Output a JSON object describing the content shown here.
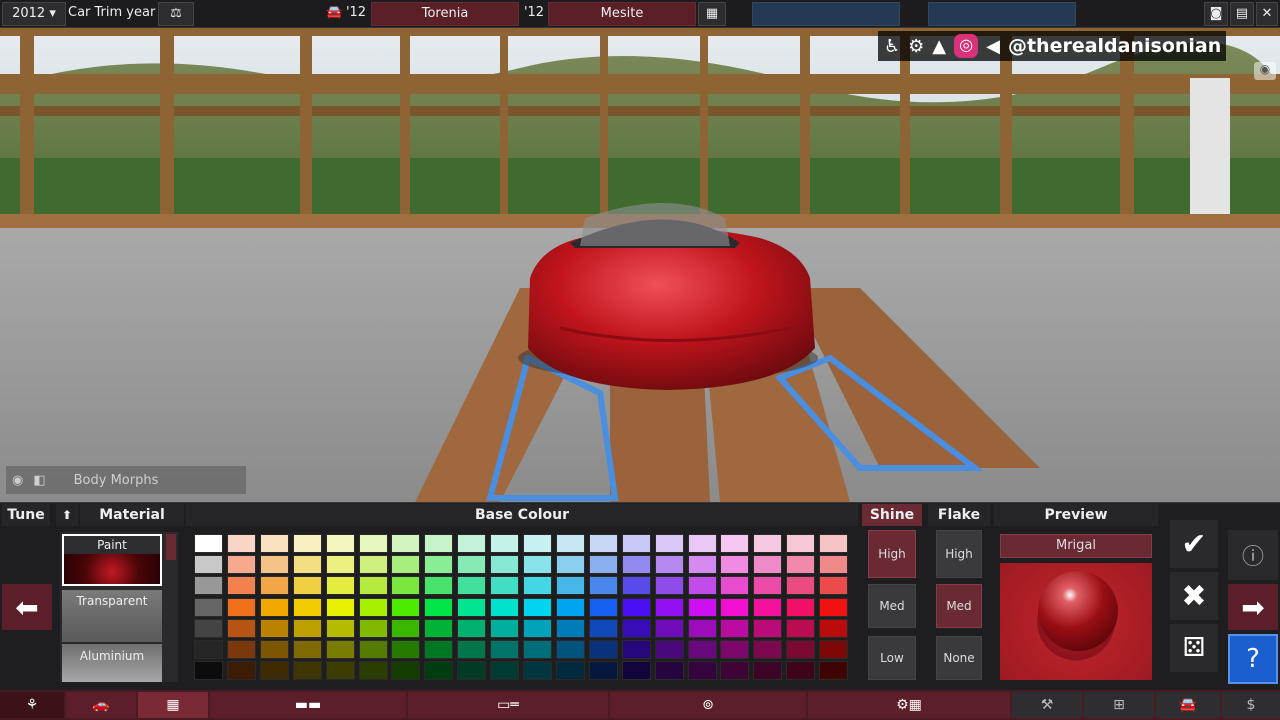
{
  "topbar": {
    "year": "2012",
    "trim_year_label": "Car Trim year",
    "model_year_short": "'12",
    "model_name": "Torenia",
    "trim_year_short": "'12",
    "trim_name": "Mesite"
  },
  "overlay": {
    "handle": "@therealdanisonian"
  },
  "body_morphs": {
    "label": "Body Morphs"
  },
  "panel": {
    "tune_label": "Tune",
    "material_header": "Material",
    "base_colour_header": "Base Colour",
    "shine_header": "Shine",
    "flake_header": "Flake",
    "preview_header": "Preview",
    "materials": [
      {
        "label": "Paint",
        "selected": true
      },
      {
        "label": "Transparent",
        "selected": false
      },
      {
        "label": "Aluminium",
        "selected": false
      }
    ],
    "shine_options": [
      {
        "label": "High",
        "selected": true
      },
      {
        "label": "Med",
        "selected": false
      },
      {
        "label": "Low",
        "selected": false
      }
    ],
    "flake_options": [
      {
        "label": "High",
        "selected": false
      },
      {
        "label": "Med",
        "selected": true
      },
      {
        "label": "None",
        "selected": false
      }
    ],
    "preview_name": "Mrigal"
  },
  "palette": [
    [
      "#ffffff",
      "#f9d5c8",
      "#f9e1c2",
      "#f8f0c0",
      "#f4f6bf",
      "#e6f6bf",
      "#d3f4bf",
      "#c7f3c8",
      "#c4f2d8",
      "#c4f2e8",
      "#c6f0f2",
      "#c8e6f4",
      "#c8d7f6",
      "#cac8f6",
      "#d9c8f6",
      "#e9c8f6",
      "#f6c8f1",
      "#f6c8e1",
      "#f6c8d4",
      "#f6c4c4"
    ],
    [
      "#c8c8c8",
      "#f5a98f",
      "#f5c387",
      "#f3df81",
      "#ecf080",
      "#cff07f",
      "#a8ee7f",
      "#8aec95",
      "#86eab6",
      "#87e9d3",
      "#88e4ea",
      "#8acfee",
      "#8bb0f0",
      "#928af0",
      "#b48af0",
      "#d48af0",
      "#f08ae3",
      "#f08ac6",
      "#f08aaa",
      "#f08a8a"
    ],
    [
      "#989898",
      "#f2814f",
      "#f2a648",
      "#f1cf42",
      "#e3ec3f",
      "#b6ea3e",
      "#79e73e",
      "#48e36a",
      "#42e09c",
      "#43ddc4",
      "#44d7e3",
      "#47b6e8",
      "#4a87ea",
      "#574cea",
      "#8f4cea",
      "#c14cea",
      "#ea4ccf",
      "#ea4ca7",
      "#ea4c7f",
      "#ea4c4c"
    ],
    [
      "#666666",
      "#ef6f1a",
      "#f0a800",
      "#f3cc00",
      "#e7f000",
      "#a6ef00",
      "#4deb00",
      "#00e646",
      "#00e592",
      "#00e2cb",
      "#00d4ee",
      "#00a4f0",
      "#1460f2",
      "#4b10f2",
      "#9310f2",
      "#cc10f2",
      "#f210d0",
      "#f2109c",
      "#f21065",
      "#f21010"
    ],
    [
      "#444444",
      "#b85413",
      "#ba8200",
      "#bd9f00",
      "#b4bb00",
      "#80ba00",
      "#3ab700",
      "#00b235",
      "#00b170",
      "#00ae9c",
      "#00a3b8",
      "#007db9",
      "#0f49ba",
      "#390cba",
      "#700cba",
      "#9d0cba",
      "#ba0ca0",
      "#ba0c78",
      "#ba0c4e",
      "#ba0c0c"
    ],
    [
      "#262626",
      "#7a380d",
      "#7c5700",
      "#7e6a00",
      "#787c00",
      "#557c00",
      "#277a00",
      "#007723",
      "#00764b",
      "#007468",
      "#006d7b",
      "#00537c",
      "#0a317c",
      "#26087c",
      "#4b087c",
      "#69087c",
      "#7c086b",
      "#7c0850",
      "#7c0834",
      "#7c0808"
    ],
    [
      "#0c0c0c",
      "#3d1c06",
      "#3e2c00",
      "#3f3500",
      "#3c3e00",
      "#2b3e00",
      "#143d00",
      "#003c12",
      "#003b26",
      "#003a34",
      "#00373e",
      "#002a3e",
      "#05183e",
      "#13043e",
      "#26043e",
      "#35043e",
      "#3e0436",
      "#3e0428",
      "#3e041a",
      "#3e0404"
    ]
  ],
  "colors": {
    "accent": "#6a2a33",
    "car_red": "#c0141c"
  }
}
